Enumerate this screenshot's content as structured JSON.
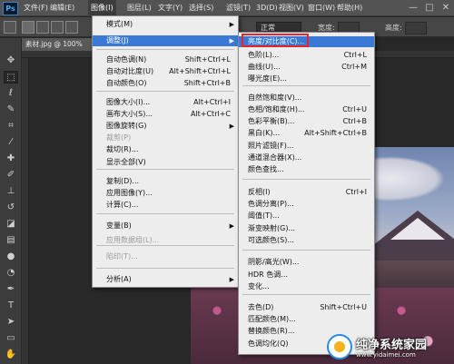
{
  "app": {
    "logo": "Ps"
  },
  "menubar": {
    "items": [
      "文件(F)",
      "编辑(E)",
      "图像(I)",
      "图层(L)",
      "文字(Y)",
      "选择(S)",
      "滤镜(T)",
      "3D(D)",
      "视图(V)",
      "窗口(W)",
      "帮助(H)"
    ],
    "active_index": 2
  },
  "window_controls": {
    "minimize": "—",
    "maximize": "□",
    "close": "✕"
  },
  "options_bar": {
    "mode_value": "正常",
    "width_label": "宽度:",
    "height_label": "高度:"
  },
  "document": {
    "tab_label": "素材.jpg @ 100%"
  },
  "image_menu": {
    "items": [
      {
        "label": "模式(M)",
        "shortcut": "",
        "submenu": true,
        "disabled": false
      },
      {
        "label": "调整(J)",
        "shortcut": "",
        "submenu": true,
        "disabled": false,
        "highlight": true
      },
      {
        "label": "自动色调(N)",
        "shortcut": "Shift+Ctrl+L",
        "submenu": false,
        "disabled": false
      },
      {
        "label": "自动对比度(U)",
        "shortcut": "Alt+Shift+Ctrl+L",
        "submenu": false,
        "disabled": false
      },
      {
        "label": "自动颜色(O)",
        "shortcut": "Shift+Ctrl+B",
        "submenu": false,
        "disabled": false
      },
      {
        "label": "图像大小(I)...",
        "shortcut": "Alt+Ctrl+I",
        "submenu": false,
        "disabled": false
      },
      {
        "label": "画布大小(S)...",
        "shortcut": "Alt+Ctrl+C",
        "submenu": false,
        "disabled": false
      },
      {
        "label": "图像旋转(G)",
        "shortcut": "",
        "submenu": true,
        "disabled": false
      },
      {
        "label": "裁剪(P)",
        "shortcut": "",
        "submenu": false,
        "disabled": true
      },
      {
        "label": "裁切(R)...",
        "shortcut": "",
        "submenu": false,
        "disabled": false
      },
      {
        "label": "显示全部(V)",
        "shortcut": "",
        "submenu": false,
        "disabled": false
      },
      {
        "label": "复制(D)...",
        "shortcut": "",
        "submenu": false,
        "disabled": false
      },
      {
        "label": "应用图像(Y)...",
        "shortcut": "",
        "submenu": false,
        "disabled": false
      },
      {
        "label": "计算(C)...",
        "shortcut": "",
        "submenu": false,
        "disabled": false
      },
      {
        "label": "变量(B)",
        "shortcut": "",
        "submenu": true,
        "disabled": false
      },
      {
        "label": "应用数据组(L)...",
        "shortcut": "",
        "submenu": false,
        "disabled": true
      },
      {
        "label": "陷印(T)...",
        "shortcut": "",
        "submenu": false,
        "disabled": true
      },
      {
        "label": "分析(A)",
        "shortcut": "",
        "submenu": true,
        "disabled": false
      }
    ]
  },
  "adjust_menu": {
    "items": [
      {
        "label": "亮度/对比度(C)...",
        "shortcut": "",
        "highlight": true
      },
      {
        "label": "色阶(L)...",
        "shortcut": "Ctrl+L"
      },
      {
        "label": "曲线(U)...",
        "shortcut": "Ctrl+M"
      },
      {
        "label": "曝光度(E)...",
        "shortcut": ""
      },
      {
        "label": "自然饱和度(V)...",
        "shortcut": ""
      },
      {
        "label": "色相/饱和度(H)...",
        "shortcut": "Ctrl+U"
      },
      {
        "label": "色彩平衡(B)...",
        "shortcut": "Ctrl+B"
      },
      {
        "label": "黑白(K)...",
        "shortcut": "Alt+Shift+Ctrl+B"
      },
      {
        "label": "照片滤镜(F)...",
        "shortcut": ""
      },
      {
        "label": "通道混合器(X)...",
        "shortcut": ""
      },
      {
        "label": "颜色查找...",
        "shortcut": ""
      },
      {
        "label": "反相(I)",
        "shortcut": "Ctrl+I"
      },
      {
        "label": "色调分离(P)...",
        "shortcut": ""
      },
      {
        "label": "阈值(T)...",
        "shortcut": ""
      },
      {
        "label": "渐变映射(G)...",
        "shortcut": ""
      },
      {
        "label": "可选颜色(S)...",
        "shortcut": ""
      },
      {
        "label": "阴影/高光(W)...",
        "shortcut": ""
      },
      {
        "label": "HDR 色调...",
        "shortcut": ""
      },
      {
        "label": "变化...",
        "shortcut": ""
      },
      {
        "label": "去色(D)",
        "shortcut": "Shift+Ctrl+U"
      },
      {
        "label": "匹配颜色(M)...",
        "shortcut": ""
      },
      {
        "label": "替换颜色(R)...",
        "shortcut": ""
      },
      {
        "label": "色调均化(Q)",
        "shortcut": ""
      }
    ]
  },
  "watermark": {
    "title": "纯净系统家园",
    "url": "www.yidaimei.com"
  },
  "colors": {
    "highlight": "#3a7ad6",
    "callout": "#e2262b"
  }
}
